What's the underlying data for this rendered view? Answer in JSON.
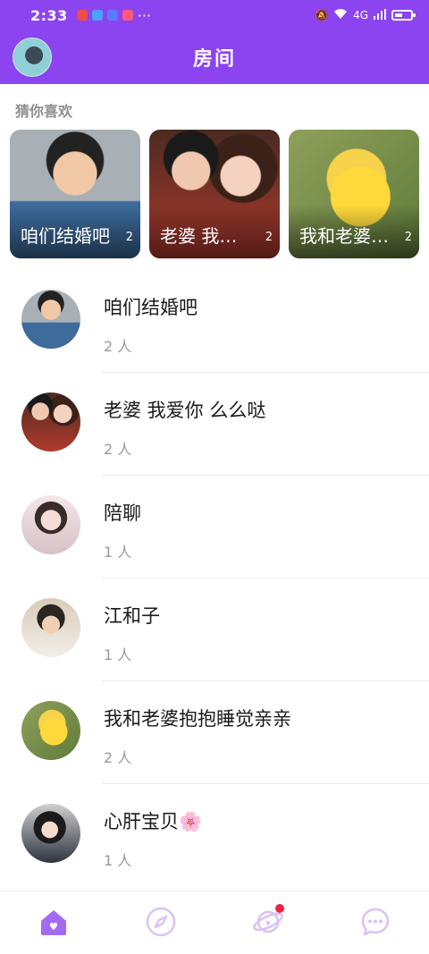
{
  "status_bar": {
    "time": "2:33",
    "network": "4G",
    "dots": "···"
  },
  "header": {
    "title": "房间"
  },
  "recommend": {
    "label": "猜你喜欢",
    "cards": [
      {
        "name": "咱们结婚吧",
        "count": "2",
        "image": "boy-portrait"
      },
      {
        "name": "老婆 我爱你 么么哒",
        "count": "2",
        "image": "couple-selfie"
      },
      {
        "name": "我和老婆抱抱睡觉亲亲",
        "count": "2",
        "image": "pikachu"
      }
    ]
  },
  "rooms": [
    {
      "name": "咱们结婚吧",
      "count": "2 人",
      "image": "boy-portrait"
    },
    {
      "name": "老婆 我爱你 么么哒",
      "count": "2 人",
      "image": "couple-selfie"
    },
    {
      "name": "陪聊",
      "count": "1 人",
      "image": "girl-portrait"
    },
    {
      "name": "江和子",
      "count": "1 人",
      "image": "young-man"
    },
    {
      "name": "我和老婆抱抱睡觉亲亲",
      "count": "2 人",
      "image": "pikachu"
    },
    {
      "name": "心肝宝贝🌸",
      "count": "1 人",
      "image": "girl-dark-hair"
    }
  ],
  "tabbar": {
    "items": [
      {
        "icon": "home-icon",
        "active": true
      },
      {
        "icon": "compass-icon",
        "active": false
      },
      {
        "icon": "planet-icon",
        "active": false,
        "badge": true
      },
      {
        "icon": "chat-bubble-icon",
        "active": false
      }
    ],
    "active_color": "#a36af3",
    "inactive_color": "#d9c2f7"
  },
  "colors": {
    "brand": "#8b44f0",
    "badge": "#f0223c"
  }
}
